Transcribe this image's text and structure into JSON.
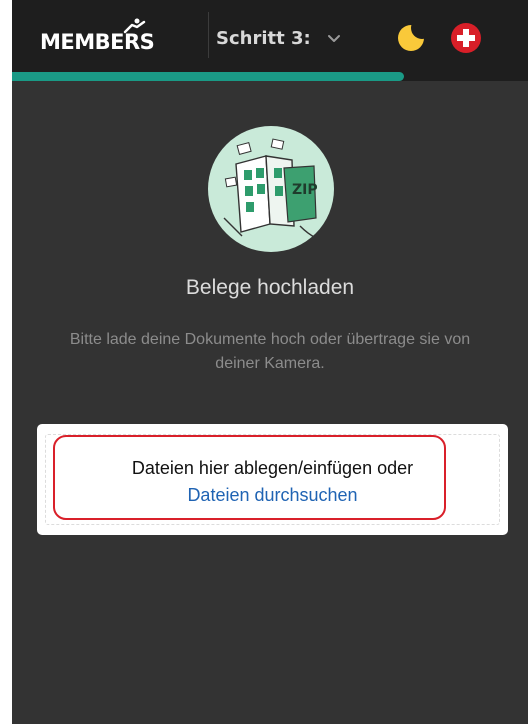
{
  "header": {
    "logo_text": "MEMBERS",
    "step_label": "Schritt 3:",
    "icons": [
      "chevron-down-icon",
      "moon-icon",
      "swiss-flag-icon"
    ]
  },
  "progress": {
    "value": 0.76
  },
  "main": {
    "illustration_label": "ZIP",
    "title": "Belege hochladen",
    "subtitle": "Bitte lade deine Dokumente hoch oder übertrage sie von deiner Kamera."
  },
  "dropzone": {
    "prompt": "Dateien hier ablegen/einfügen oder",
    "browse_label": "Dateien durchsuchen"
  },
  "colors": {
    "accent": "#1a9a86",
    "link": "#1f63b3",
    "highlight": "#d9202a",
    "background": "#333333",
    "header": "#1e1e1e"
  }
}
